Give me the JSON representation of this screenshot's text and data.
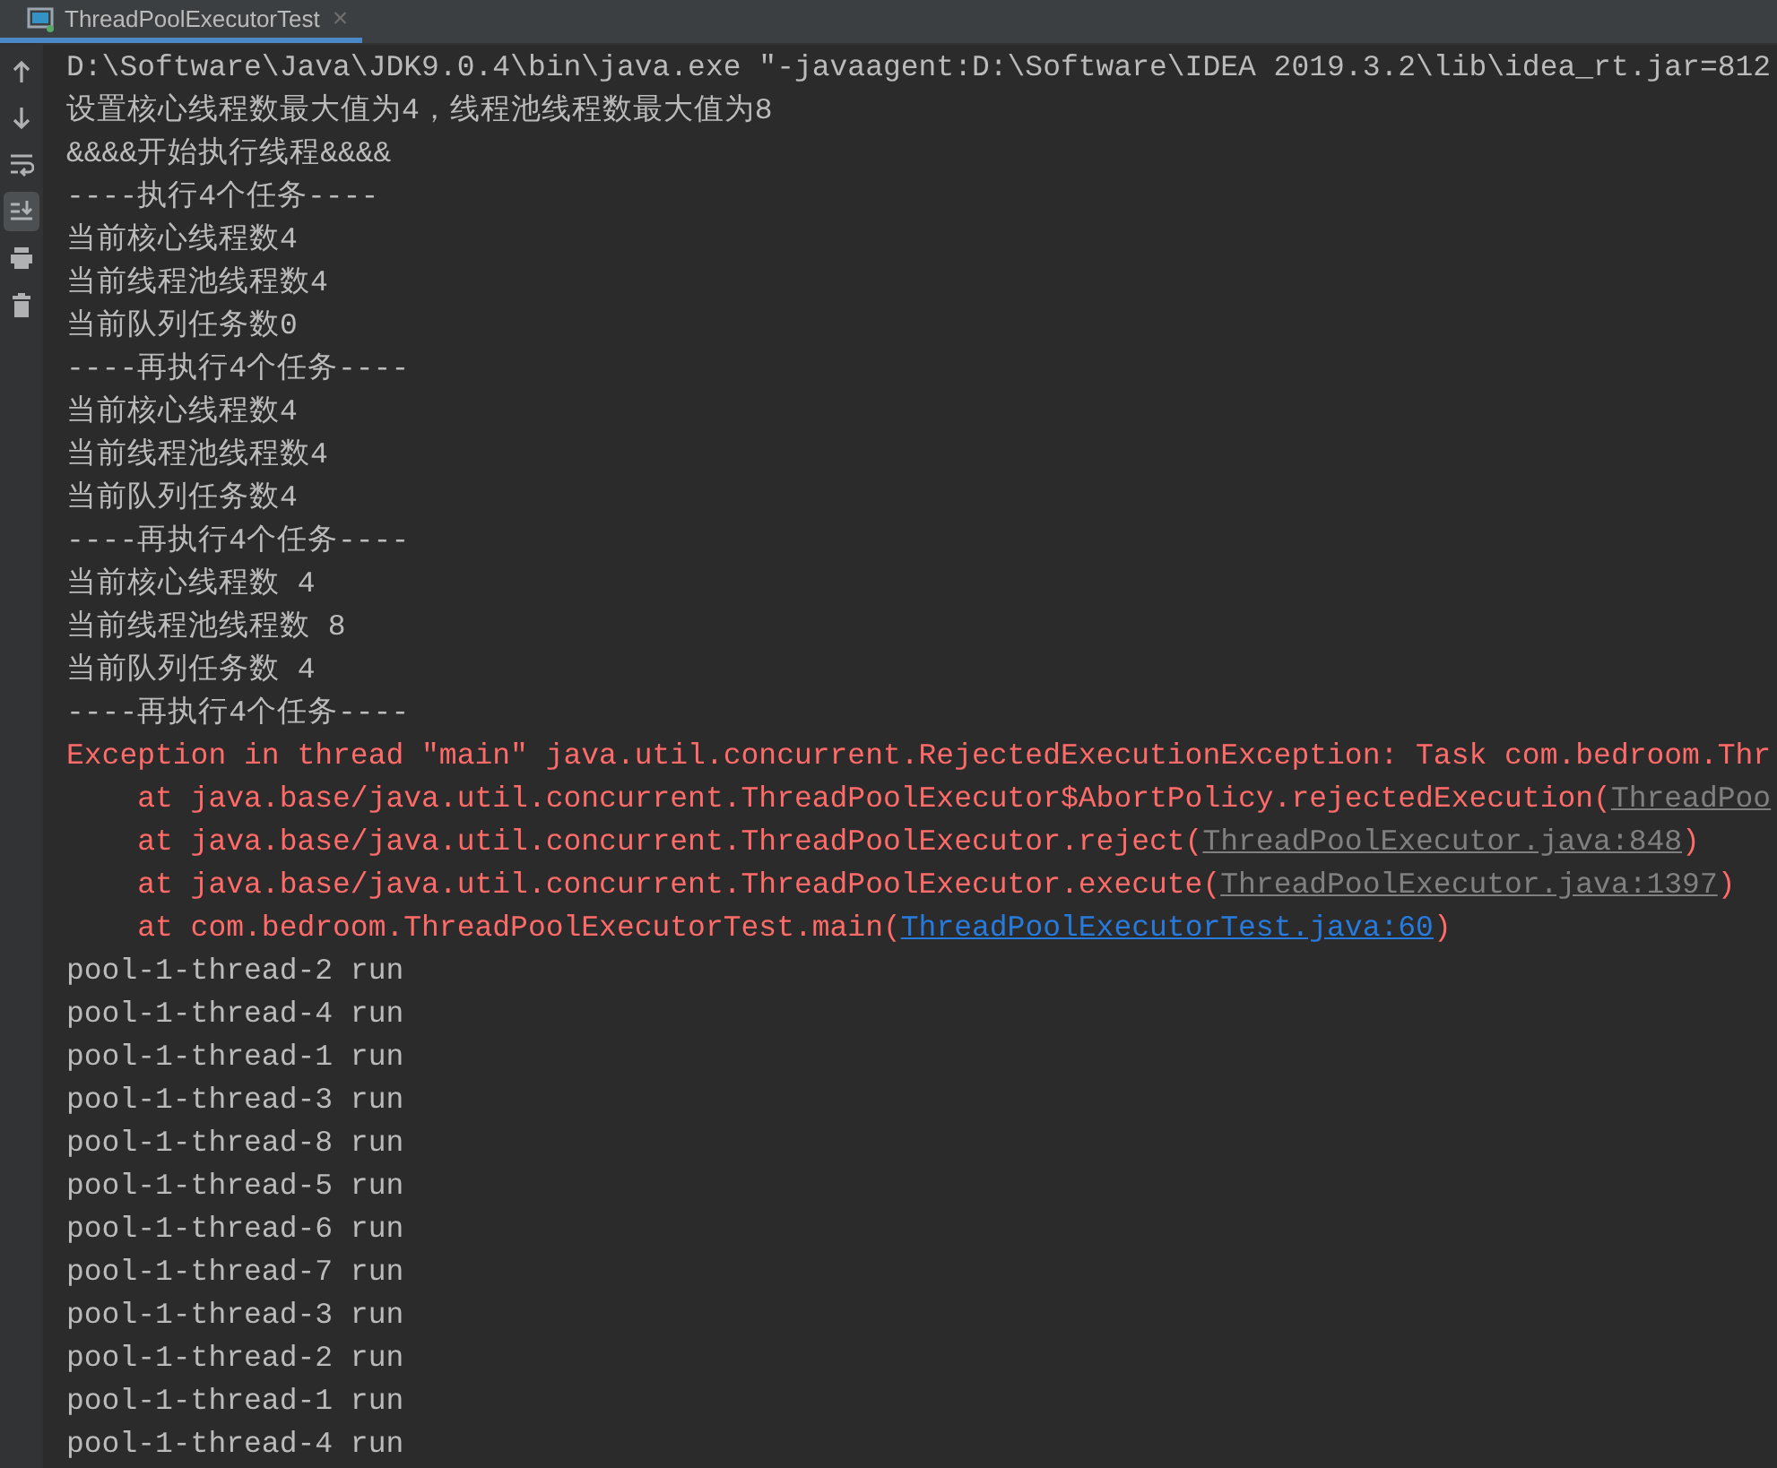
{
  "tab": {
    "title": "ThreadPoolExecutorTest",
    "close": "×",
    "selected": true
  },
  "toolbar": [
    {
      "kind": "up",
      "selected": false
    },
    {
      "kind": "down",
      "selected": false
    },
    {
      "kind": "wrap",
      "selected": false
    },
    {
      "kind": "scroll-end",
      "selected": true
    },
    {
      "kind": "print",
      "selected": false
    },
    {
      "kind": "trash",
      "selected": false
    }
  ],
  "lines": [
    {
      "kind": "out",
      "text": "D:\\Software\\Java\\JDK9.0.4\\bin\\java.exe \"-javaagent:D:\\Software\\IDEA 2019.3.2\\lib\\idea_rt.jar=812"
    },
    {
      "kind": "out",
      "text": "设置核心线程数最大值为4，线程池线程数最大值为8"
    },
    {
      "kind": "out",
      "text": "&&&&开始执行线程&&&&"
    },
    {
      "kind": "out",
      "text": "----执行4个任务----"
    },
    {
      "kind": "out",
      "text": "当前核心线程数4"
    },
    {
      "kind": "out",
      "text": "当前线程池线程数4"
    },
    {
      "kind": "out",
      "text": "当前队列任务数0"
    },
    {
      "kind": "out",
      "text": "----再执行4个任务----"
    },
    {
      "kind": "out",
      "text": "当前核心线程数4"
    },
    {
      "kind": "out",
      "text": "当前线程池线程数4"
    },
    {
      "kind": "out",
      "text": "当前队列任务数4"
    },
    {
      "kind": "out",
      "text": "----再执行4个任务----"
    },
    {
      "kind": "out",
      "text": "当前核心线程数 4"
    },
    {
      "kind": "out",
      "text": "当前线程池线程数 8"
    },
    {
      "kind": "out",
      "text": "当前队列任务数 4"
    },
    {
      "kind": "out",
      "text": "----再执行4个任务----"
    },
    {
      "kind": "err",
      "text": "Exception in thread \"main\" java.util.concurrent.RejectedExecutionException: Task com.bedroom.Thr"
    },
    {
      "kind": "stack",
      "text": "    at java.base/java.util.concurrent.ThreadPoolExecutor$AbortPolicy.rejectedExecution(",
      "link": {
        "text": "ThreadPoo",
        "color": "#808080"
      }
    },
    {
      "kind": "stack",
      "text": "    at java.base/java.util.concurrent.ThreadPoolExecutor.reject(",
      "link": {
        "text": "ThreadPoolExecutor.java:848",
        "color": "#808080"
      },
      "after": ")"
    },
    {
      "kind": "stack",
      "text": "    at java.base/java.util.concurrent.ThreadPoolExecutor.execute(",
      "link": {
        "text": "ThreadPoolExecutor.java:1397",
        "color": "#808080"
      },
      "after": ")"
    },
    {
      "kind": "stack",
      "text": "    at com.bedroom.ThreadPoolExecutorTest.main(",
      "link": {
        "text": "ThreadPoolExecutorTest.java:60",
        "color": "#287bde"
      },
      "after": ")"
    },
    {
      "kind": "out",
      "text": "pool-1-thread-2 run"
    },
    {
      "kind": "out",
      "text": "pool-1-thread-4 run"
    },
    {
      "kind": "out",
      "text": "pool-1-thread-1 run"
    },
    {
      "kind": "out",
      "text": "pool-1-thread-3 run"
    },
    {
      "kind": "out",
      "text": "pool-1-thread-8 run"
    },
    {
      "kind": "out",
      "text": "pool-1-thread-5 run"
    },
    {
      "kind": "out",
      "text": "pool-1-thread-6 run"
    },
    {
      "kind": "out",
      "text": "pool-1-thread-7 run"
    },
    {
      "kind": "out",
      "text": "pool-1-thread-3 run"
    },
    {
      "kind": "out",
      "text": "pool-1-thread-2 run"
    },
    {
      "kind": "out",
      "text": "pool-1-thread-1 run"
    },
    {
      "kind": "out",
      "text": "pool-1-thread-4 run"
    }
  ]
}
